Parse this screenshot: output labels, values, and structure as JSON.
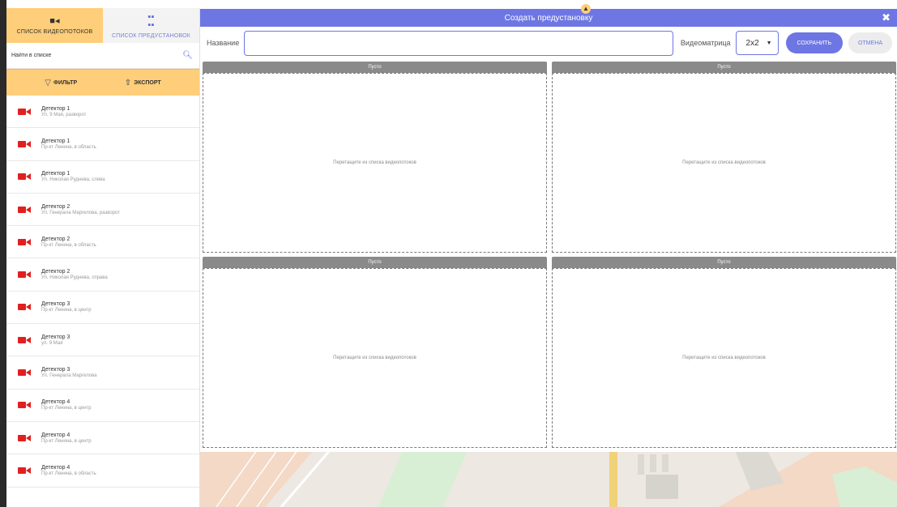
{
  "sidebar": {
    "tabs": [
      {
        "label": "список видеопотоков",
        "icon": "video-camera-icon"
      },
      {
        "label": "список предустановок",
        "icon": "grid-icon"
      }
    ],
    "search": {
      "placeholder": "Найти в списке"
    },
    "tools": {
      "filter_label": "фильтр",
      "export_label": "экспорт"
    },
    "streams": [
      {
        "title": "Детектор 1",
        "sub": "Ул. 9 Мая, разворот"
      },
      {
        "title": "Детектор 1",
        "sub": "Пр-кт Ленина, в область"
      },
      {
        "title": "Детектор 1",
        "sub": "Ул. Николая Руднева, слева"
      },
      {
        "title": "Детектор 2",
        "sub": "Ул. Генерала Маргелова, разворот"
      },
      {
        "title": "Детектор 2",
        "sub": "Пр-кт Ленина, в область"
      },
      {
        "title": "Детектор 2",
        "sub": "Ул. Николая Руднева, справа"
      },
      {
        "title": "Детектор 3",
        "sub": "Пр-кт Ленина, в центр"
      },
      {
        "title": "Детектор 3",
        "sub": "ул. 9 Мая"
      },
      {
        "title": "Детектор 3",
        "sub": "Ул. Генерала Маргелова"
      },
      {
        "title": "Детектор 4",
        "sub": "Пр-кт Ленина, в центр"
      },
      {
        "title": "Детектор 4",
        "sub": "Пр-кт Ленина, в центр"
      },
      {
        "title": "Детектор 4",
        "sub": "Пр-кт Ленина, в область"
      }
    ]
  },
  "modal": {
    "title": "Создать предустановку",
    "name_label": "Название",
    "name_value": "",
    "matrix_label": "Видеоматрица",
    "matrix_value": "2x2",
    "save_label": "сохранить",
    "cancel_label": "отмена",
    "cells": [
      {
        "header": "Пусто",
        "hint": "Перетащите из списка видеопотоков"
      },
      {
        "header": "Пусто",
        "hint": "Перетащите из списка видеопотоков"
      },
      {
        "header": "Пусто",
        "hint": "Перетащите из списка видеопотоков"
      },
      {
        "header": "Пусто",
        "hint": "Перетащите из списка видеопотоков"
      }
    ]
  },
  "colors": {
    "accent": "#6d76e3",
    "sidebar_active": "#ffce7a",
    "camera_red": "#e02020"
  }
}
